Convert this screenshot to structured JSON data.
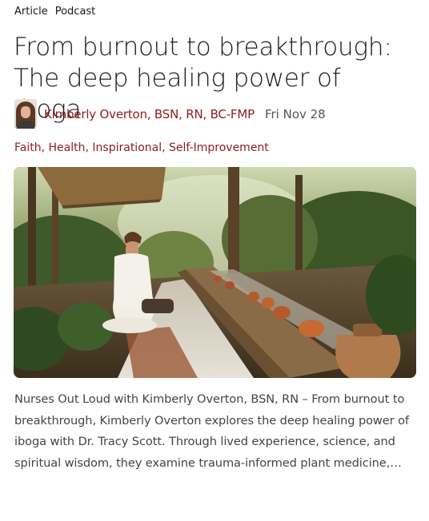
{
  "post_types": [
    "Article",
    "Podcast"
  ],
  "title": "From burnout to breakthrough: The deep healing power of Iboga",
  "author": {
    "name": "Kimberly Overton, BSN, RN, BC-FMP",
    "date": "Fri Nov 28"
  },
  "categories": [
    "Faith",
    "Health",
    "Inspirational",
    "Self-Improvement"
  ],
  "categories_separator": ", ",
  "excerpt": "Nurses Out Loud with Kimberly Overton, BSN, RN – From burnout to breakthrough, Kimberly Overton explores the deep healing power of iboga with Dr. Tracy Scott. Through lived experience, science, and spiritual wisdom, they examine trauma-informed plant medicine,…",
  "colors": {
    "accent": "#8f1c1c",
    "text": "#1a1a1a",
    "muted": "#444444"
  }
}
